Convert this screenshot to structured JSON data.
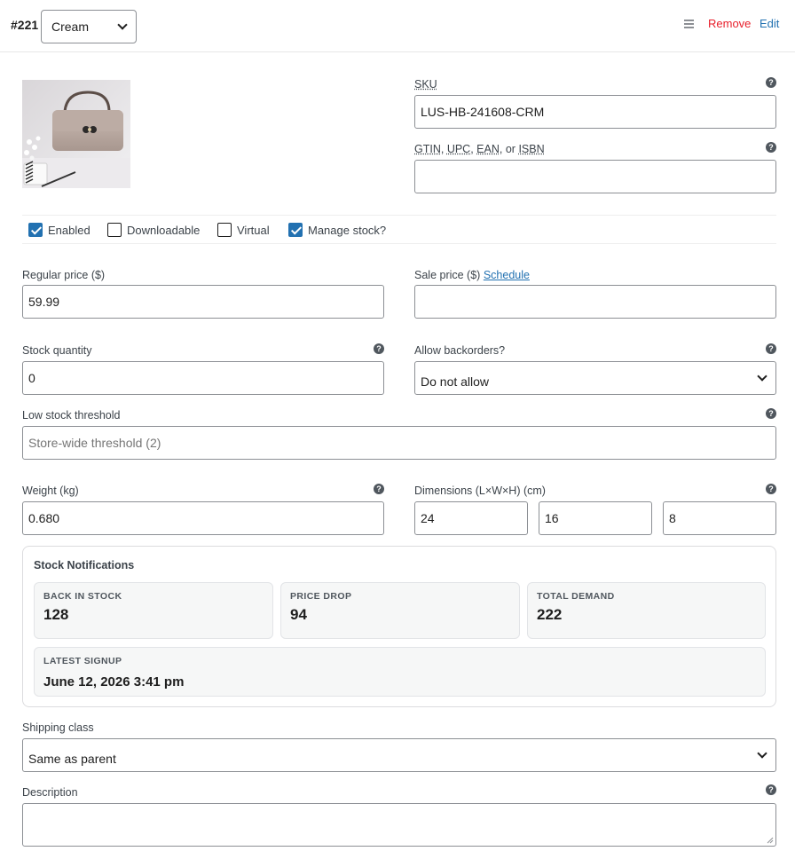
{
  "header": {
    "variation_id": "#221",
    "attribute_value": "Cream",
    "remove_label": "Remove",
    "edit_label": "Edit"
  },
  "sku": {
    "label": "SKU",
    "value": "LUS-HB-241608-CRM"
  },
  "gtin": {
    "label_parts": [
      "GTIN",
      "UPC",
      "EAN",
      "or",
      "ISBN"
    ],
    "value": ""
  },
  "options": {
    "enabled": {
      "label": "Enabled",
      "checked": true
    },
    "downloadable": {
      "label": "Downloadable",
      "checked": false
    },
    "virtual": {
      "label": "Virtual",
      "checked": false
    },
    "manage_stock": {
      "label": "Manage stock?",
      "checked": true
    }
  },
  "pricing": {
    "regular_label": "Regular price ($)",
    "regular_value": "59.99",
    "sale_label": "Sale price ($)",
    "schedule_link": "Schedule",
    "sale_value": ""
  },
  "stock": {
    "quantity_label": "Stock quantity",
    "quantity_value": "0",
    "backorders_label": "Allow backorders?",
    "backorders_value": "Do not allow",
    "low_stock_label": "Low stock threshold",
    "low_stock_placeholder": "Store-wide threshold (2)"
  },
  "shipping": {
    "weight_label": "Weight (kg)",
    "weight_value": "0.680",
    "dimensions_label": "Dimensions (L×W×H) (cm)",
    "length": "24",
    "width": "16",
    "height": "8",
    "class_label": "Shipping class",
    "class_value": "Same as parent"
  },
  "notifications": {
    "title": "Stock Notifications",
    "back_in_stock": {
      "label": "BACK IN STOCK",
      "value": "128"
    },
    "price_drop": {
      "label": "PRICE DROP",
      "value": "94"
    },
    "total_demand": {
      "label": "TOTAL DEMAND",
      "value": "222"
    },
    "latest_signup": {
      "label": "LATEST SIGNUP",
      "value": "June 12, 2026 3:41 pm"
    }
  },
  "description": {
    "label": "Description",
    "value": ""
  },
  "colors": {
    "accent": "#2271b1",
    "remove": "#e8202c",
    "border": "#8c8f94"
  },
  "icons": {
    "help": "question-circle-icon",
    "drag": "drag-handle-icon",
    "chevron": "chevron-down-icon"
  }
}
